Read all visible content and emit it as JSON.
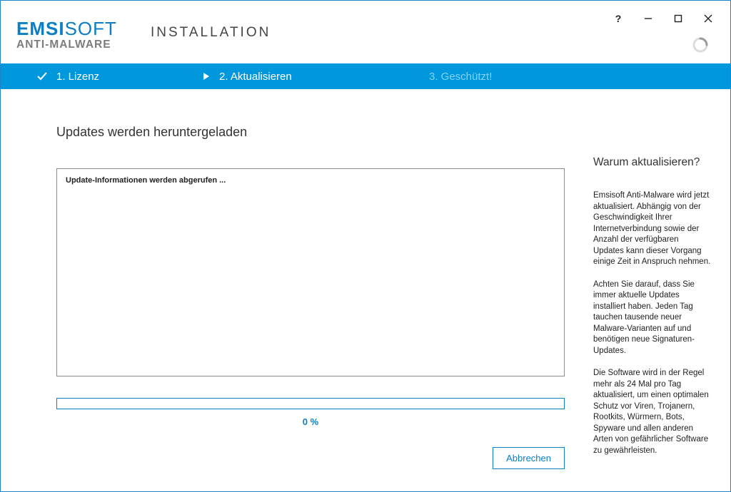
{
  "brand": {
    "line1a": "EMSI",
    "line1b": "SOFT",
    "line2": "ANTI-MALWARE"
  },
  "app_title": "INSTALLATION",
  "steps": {
    "s1": "1. Lizenz",
    "s2": "2. Aktualisieren",
    "s3": "3. Geschützt!"
  },
  "main": {
    "heading": "Updates werden heruntergeladen",
    "log_line": "Update-Informationen werden abgerufen ...",
    "progress_text": "0 %",
    "cancel": "Abbrechen"
  },
  "side": {
    "heading": "Warum aktualisieren?",
    "p1": "Emsisoft Anti-Malware wird jetzt aktualisiert. Abhängig von der Geschwindigkeit Ihrer Internetverbindung sowie der Anzahl der verfügbaren Updates kann dieser Vorgang einige Zeit in Anspruch nehmen.",
    "p2": "Achten Sie darauf, dass Sie immer aktuelle Updates installiert haben. Jeden Tag tauchen tausende neuer Malware-Varianten auf und benötigen neue Signaturen-Updates.",
    "p3": "Die Software wird in der Regel mehr als 24 Mal pro Tag aktualisiert, um einen optimalen Schutz vor Viren, Trojanern, Rootkits, Würmern, Bots, Spyware und allen anderen Arten von gefährlicher Software zu gewährleisten."
  }
}
